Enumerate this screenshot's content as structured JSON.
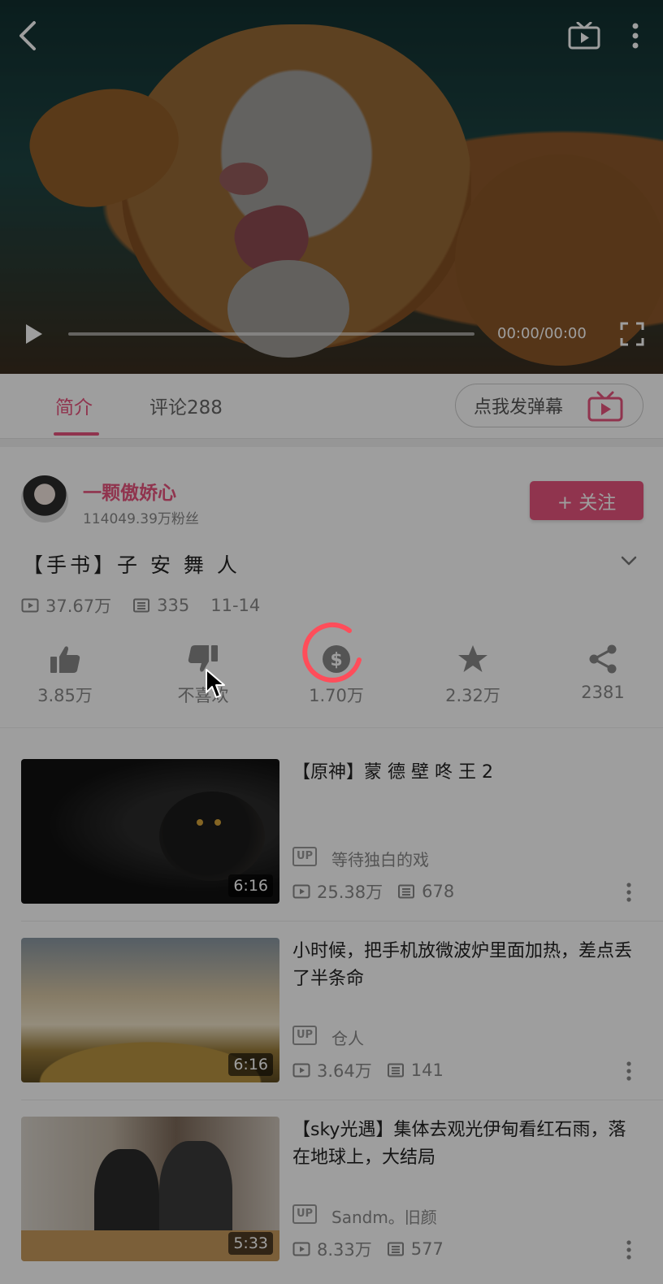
{
  "player": {
    "time": "00:00/00:00"
  },
  "tabs": {
    "intro": "简介",
    "comments": "评论288",
    "danmu_button": "点我发弹幕"
  },
  "uploader": {
    "name": "一颗傲娇心",
    "fans": "114049.39万粉丝",
    "follow": "+ 关注"
  },
  "video": {
    "title": "【手书】子 安 舞 人",
    "views": "37.67万",
    "danmaku": "335",
    "date": "11-14"
  },
  "actions": [
    {
      "name": "like",
      "icon": "thumbs-up-icon",
      "label": "3.85万"
    },
    {
      "name": "dislike",
      "icon": "thumbs-down-icon",
      "label": "不喜欢"
    },
    {
      "name": "coin",
      "icon": "coin-icon",
      "label": "1.70万"
    },
    {
      "name": "favorite",
      "icon": "star-icon",
      "label": "2.32万"
    },
    {
      "name": "share",
      "icon": "share-icon",
      "label": "2381"
    }
  ],
  "related": [
    {
      "title": "【原神】蒙 德 壁 咚 王 2",
      "duration": "6:16",
      "uploader": "等待独白的戏",
      "views": "25.38万",
      "danmaku": "678"
    },
    {
      "title": "小时候，把手机放微波炉里面加热，差点丢了半条命",
      "duration": "6:16",
      "uploader": "仓人",
      "views": "3.64万",
      "danmaku": "141"
    },
    {
      "title": "【sky光遇】集体去观光伊甸看红石雨，落在地球上，大结局",
      "duration": "5:33",
      "uploader": "Sandm。旧颜",
      "views": "8.33万",
      "danmaku": "577"
    }
  ],
  "up_badge": "UP",
  "colors": {
    "accent": "#e8557e",
    "spinner": "#ff4d5a"
  }
}
